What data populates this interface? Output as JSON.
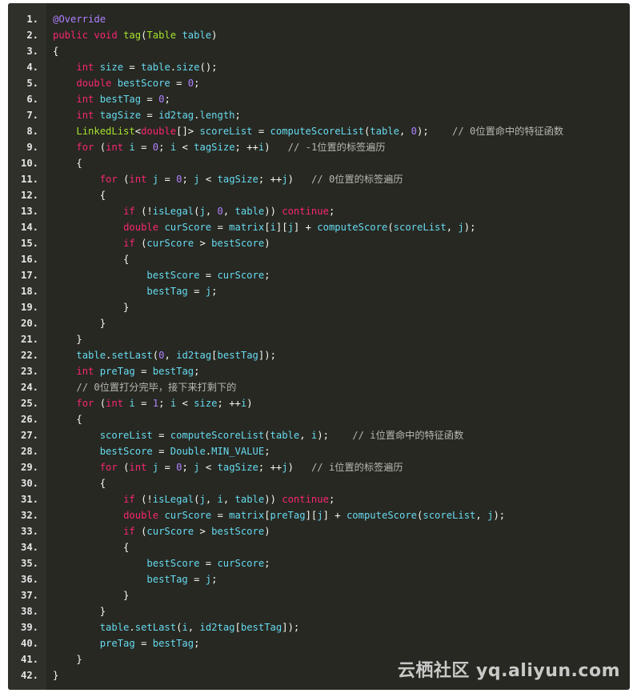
{
  "lines": [
    [
      [
        "a",
        "@Override"
      ]
    ],
    [
      [
        "k",
        "public "
      ],
      [
        "k",
        "void "
      ],
      [
        "t",
        "tag"
      ],
      [
        "p",
        "("
      ],
      [
        "t",
        "Table "
      ],
      [
        "n",
        "table"
      ],
      [
        "p",
        ")"
      ]
    ],
    [
      [
        "p",
        "{"
      ]
    ],
    [
      [
        "p",
        "    "
      ],
      [
        "k",
        "int "
      ],
      [
        "n",
        "size"
      ],
      [
        "p",
        " = "
      ],
      [
        "n",
        "table"
      ],
      [
        "p",
        "."
      ],
      [
        "n",
        "size"
      ],
      [
        "p",
        "();"
      ]
    ],
    [
      [
        "p",
        "    "
      ],
      [
        "k",
        "double "
      ],
      [
        "n",
        "bestScore"
      ],
      [
        "p",
        " = "
      ],
      [
        "num",
        "0"
      ],
      [
        "p",
        ";"
      ]
    ],
    [
      [
        "p",
        "    "
      ],
      [
        "k",
        "int "
      ],
      [
        "n",
        "bestTag"
      ],
      [
        "p",
        " = "
      ],
      [
        "num",
        "0"
      ],
      [
        "p",
        ";"
      ]
    ],
    [
      [
        "p",
        "    "
      ],
      [
        "k",
        "int "
      ],
      [
        "n",
        "tagSize"
      ],
      [
        "p",
        " = "
      ],
      [
        "n",
        "id2tag"
      ],
      [
        "p",
        "."
      ],
      [
        "n",
        "length"
      ],
      [
        "p",
        ";"
      ]
    ],
    [
      [
        "p",
        "    "
      ],
      [
        "t",
        "LinkedList"
      ],
      [
        "p",
        "<"
      ],
      [
        "k",
        "double"
      ],
      [
        "p",
        "[]> "
      ],
      [
        "n",
        "scoreList"
      ],
      [
        "p",
        " = "
      ],
      [
        "n",
        "computeScoreList"
      ],
      [
        "p",
        "("
      ],
      [
        "n",
        "table"
      ],
      [
        "p",
        ", "
      ],
      [
        "num",
        "0"
      ],
      [
        "p",
        ");    "
      ],
      [
        "c",
        "// 0位置命中的特征函数"
      ]
    ],
    [
      [
        "p",
        "    "
      ],
      [
        "k",
        "for "
      ],
      [
        "p",
        "("
      ],
      [
        "k",
        "int "
      ],
      [
        "n",
        "i"
      ],
      [
        "p",
        " = "
      ],
      [
        "num",
        "0"
      ],
      [
        "p",
        "; "
      ],
      [
        "n",
        "i"
      ],
      [
        "p",
        " < "
      ],
      [
        "n",
        "tagSize"
      ],
      [
        "p",
        "; ++"
      ],
      [
        "n",
        "i"
      ],
      [
        "p",
        ")   "
      ],
      [
        "c",
        "// -1位置的标签遍历"
      ]
    ],
    [
      [
        "p",
        "    {"
      ]
    ],
    [
      [
        "p",
        "        "
      ],
      [
        "k",
        "for "
      ],
      [
        "p",
        "("
      ],
      [
        "k",
        "int "
      ],
      [
        "n",
        "j"
      ],
      [
        "p",
        " = "
      ],
      [
        "num",
        "0"
      ],
      [
        "p",
        "; "
      ],
      [
        "n",
        "j"
      ],
      [
        "p",
        " < "
      ],
      [
        "n",
        "tagSize"
      ],
      [
        "p",
        "; ++"
      ],
      [
        "n",
        "j"
      ],
      [
        "p",
        ")   "
      ],
      [
        "c",
        "// 0位置的标签遍历"
      ]
    ],
    [
      [
        "p",
        "        {"
      ]
    ],
    [
      [
        "p",
        "            "
      ],
      [
        "k",
        "if "
      ],
      [
        "p",
        "(!"
      ],
      [
        "n",
        "isLegal"
      ],
      [
        "p",
        "("
      ],
      [
        "n",
        "j"
      ],
      [
        "p",
        ", "
      ],
      [
        "num",
        "0"
      ],
      [
        "p",
        ", "
      ],
      [
        "n",
        "table"
      ],
      [
        "p",
        ")) "
      ],
      [
        "k",
        "continue"
      ],
      [
        "p",
        ";"
      ]
    ],
    [
      [
        "p",
        "            "
      ],
      [
        "k",
        "double "
      ],
      [
        "n",
        "curScore"
      ],
      [
        "p",
        " = "
      ],
      [
        "n",
        "matrix"
      ],
      [
        "p",
        "["
      ],
      [
        "n",
        "i"
      ],
      [
        "p",
        "]["
      ],
      [
        "n",
        "j"
      ],
      [
        "p",
        "] + "
      ],
      [
        "n",
        "computeScore"
      ],
      [
        "p",
        "("
      ],
      [
        "n",
        "scoreList"
      ],
      [
        "p",
        ", "
      ],
      [
        "n",
        "j"
      ],
      [
        "p",
        ");"
      ]
    ],
    [
      [
        "p",
        "            "
      ],
      [
        "k",
        "if "
      ],
      [
        "p",
        "("
      ],
      [
        "n",
        "curScore"
      ],
      [
        "p",
        " > "
      ],
      [
        "n",
        "bestScore"
      ],
      [
        "p",
        ")"
      ]
    ],
    [
      [
        "p",
        "            {"
      ]
    ],
    [
      [
        "p",
        "                "
      ],
      [
        "n",
        "bestScore"
      ],
      [
        "p",
        " = "
      ],
      [
        "n",
        "curScore"
      ],
      [
        "p",
        ";"
      ]
    ],
    [
      [
        "p",
        "                "
      ],
      [
        "n",
        "bestTag"
      ],
      [
        "p",
        " = "
      ],
      [
        "n",
        "j"
      ],
      [
        "p",
        ";"
      ]
    ],
    [
      [
        "p",
        "            }"
      ]
    ],
    [
      [
        "p",
        "        }"
      ]
    ],
    [
      [
        "p",
        "    }"
      ]
    ],
    [
      [
        "p",
        "    "
      ],
      [
        "n",
        "table"
      ],
      [
        "p",
        "."
      ],
      [
        "n",
        "setLast"
      ],
      [
        "p",
        "("
      ],
      [
        "num",
        "0"
      ],
      [
        "p",
        ", "
      ],
      [
        "n",
        "id2tag"
      ],
      [
        "p",
        "["
      ],
      [
        "n",
        "bestTag"
      ],
      [
        "p",
        "]);"
      ]
    ],
    [
      [
        "p",
        "    "
      ],
      [
        "k",
        "int "
      ],
      [
        "n",
        "preTag"
      ],
      [
        "p",
        " = "
      ],
      [
        "n",
        "bestTag"
      ],
      [
        "p",
        ";"
      ]
    ],
    [
      [
        "p",
        "    "
      ],
      [
        "c",
        "// 0位置打分完毕，接下来打剩下的"
      ]
    ],
    [
      [
        "p",
        "    "
      ],
      [
        "k",
        "for "
      ],
      [
        "p",
        "("
      ],
      [
        "k",
        "int "
      ],
      [
        "n",
        "i"
      ],
      [
        "p",
        " = "
      ],
      [
        "num",
        "1"
      ],
      [
        "p",
        "; "
      ],
      [
        "n",
        "i"
      ],
      [
        "p",
        " < "
      ],
      [
        "n",
        "size"
      ],
      [
        "p",
        "; ++"
      ],
      [
        "n",
        "i"
      ],
      [
        "p",
        ")"
      ]
    ],
    [
      [
        "p",
        "    {"
      ]
    ],
    [
      [
        "p",
        "        "
      ],
      [
        "n",
        "scoreList"
      ],
      [
        "p",
        " = "
      ],
      [
        "n",
        "computeScoreList"
      ],
      [
        "p",
        "("
      ],
      [
        "n",
        "table"
      ],
      [
        "p",
        ", "
      ],
      [
        "n",
        "i"
      ],
      [
        "p",
        ");    "
      ],
      [
        "c",
        "// i位置命中的特征函数"
      ]
    ],
    [
      [
        "p",
        "        "
      ],
      [
        "n",
        "bestScore"
      ],
      [
        "p",
        " = "
      ],
      [
        "n",
        "Double"
      ],
      [
        "p",
        "."
      ],
      [
        "n",
        "MIN_VALUE"
      ],
      [
        "p",
        ";"
      ]
    ],
    [
      [
        "p",
        "        "
      ],
      [
        "k",
        "for "
      ],
      [
        "p",
        "("
      ],
      [
        "k",
        "int "
      ],
      [
        "n",
        "j"
      ],
      [
        "p",
        " = "
      ],
      [
        "num",
        "0"
      ],
      [
        "p",
        "; "
      ],
      [
        "n",
        "j"
      ],
      [
        "p",
        " < "
      ],
      [
        "n",
        "tagSize"
      ],
      [
        "p",
        "; ++"
      ],
      [
        "n",
        "j"
      ],
      [
        "p",
        ")   "
      ],
      [
        "c",
        "// i位置的标签遍历"
      ]
    ],
    [
      [
        "p",
        "        {"
      ]
    ],
    [
      [
        "p",
        "            "
      ],
      [
        "k",
        "if "
      ],
      [
        "p",
        "(!"
      ],
      [
        "n",
        "isLegal"
      ],
      [
        "p",
        "("
      ],
      [
        "n",
        "j"
      ],
      [
        "p",
        ", "
      ],
      [
        "n",
        "i"
      ],
      [
        "p",
        ", "
      ],
      [
        "n",
        "table"
      ],
      [
        "p",
        ")) "
      ],
      [
        "k",
        "continue"
      ],
      [
        "p",
        ";"
      ]
    ],
    [
      [
        "p",
        "            "
      ],
      [
        "k",
        "double "
      ],
      [
        "n",
        "curScore"
      ],
      [
        "p",
        " = "
      ],
      [
        "n",
        "matrix"
      ],
      [
        "p",
        "["
      ],
      [
        "n",
        "preTag"
      ],
      [
        "p",
        "]["
      ],
      [
        "n",
        "j"
      ],
      [
        "p",
        "] + "
      ],
      [
        "n",
        "computeScore"
      ],
      [
        "p",
        "("
      ],
      [
        "n",
        "scoreList"
      ],
      [
        "p",
        ", "
      ],
      [
        "n",
        "j"
      ],
      [
        "p",
        ");"
      ]
    ],
    [
      [
        "p",
        "            "
      ],
      [
        "k",
        "if "
      ],
      [
        "p",
        "("
      ],
      [
        "n",
        "curScore"
      ],
      [
        "p",
        " > "
      ],
      [
        "n",
        "bestScore"
      ],
      [
        "p",
        ")"
      ]
    ],
    [
      [
        "p",
        "            {"
      ]
    ],
    [
      [
        "p",
        "                "
      ],
      [
        "n",
        "bestScore"
      ],
      [
        "p",
        " = "
      ],
      [
        "n",
        "curScore"
      ],
      [
        "p",
        ";"
      ]
    ],
    [
      [
        "p",
        "                "
      ],
      [
        "n",
        "bestTag"
      ],
      [
        "p",
        " = "
      ],
      [
        "n",
        "j"
      ],
      [
        "p",
        ";"
      ]
    ],
    [
      [
        "p",
        "            }"
      ]
    ],
    [
      [
        "p",
        "        }"
      ]
    ],
    [
      [
        "p",
        "        "
      ],
      [
        "n",
        "table"
      ],
      [
        "p",
        "."
      ],
      [
        "n",
        "setLast"
      ],
      [
        "p",
        "("
      ],
      [
        "n",
        "i"
      ],
      [
        "p",
        ", "
      ],
      [
        "n",
        "id2tag"
      ],
      [
        "p",
        "["
      ],
      [
        "n",
        "bestTag"
      ],
      [
        "p",
        "]);"
      ]
    ],
    [
      [
        "p",
        "        "
      ],
      [
        "n",
        "preTag"
      ],
      [
        "p",
        " = "
      ],
      [
        "n",
        "bestTag"
      ],
      [
        "p",
        ";"
      ]
    ],
    [
      [
        "p",
        "    }"
      ]
    ],
    [
      [
        "p",
        "}"
      ]
    ]
  ],
  "watermark": "云栖社区 yq.aliyun.com"
}
